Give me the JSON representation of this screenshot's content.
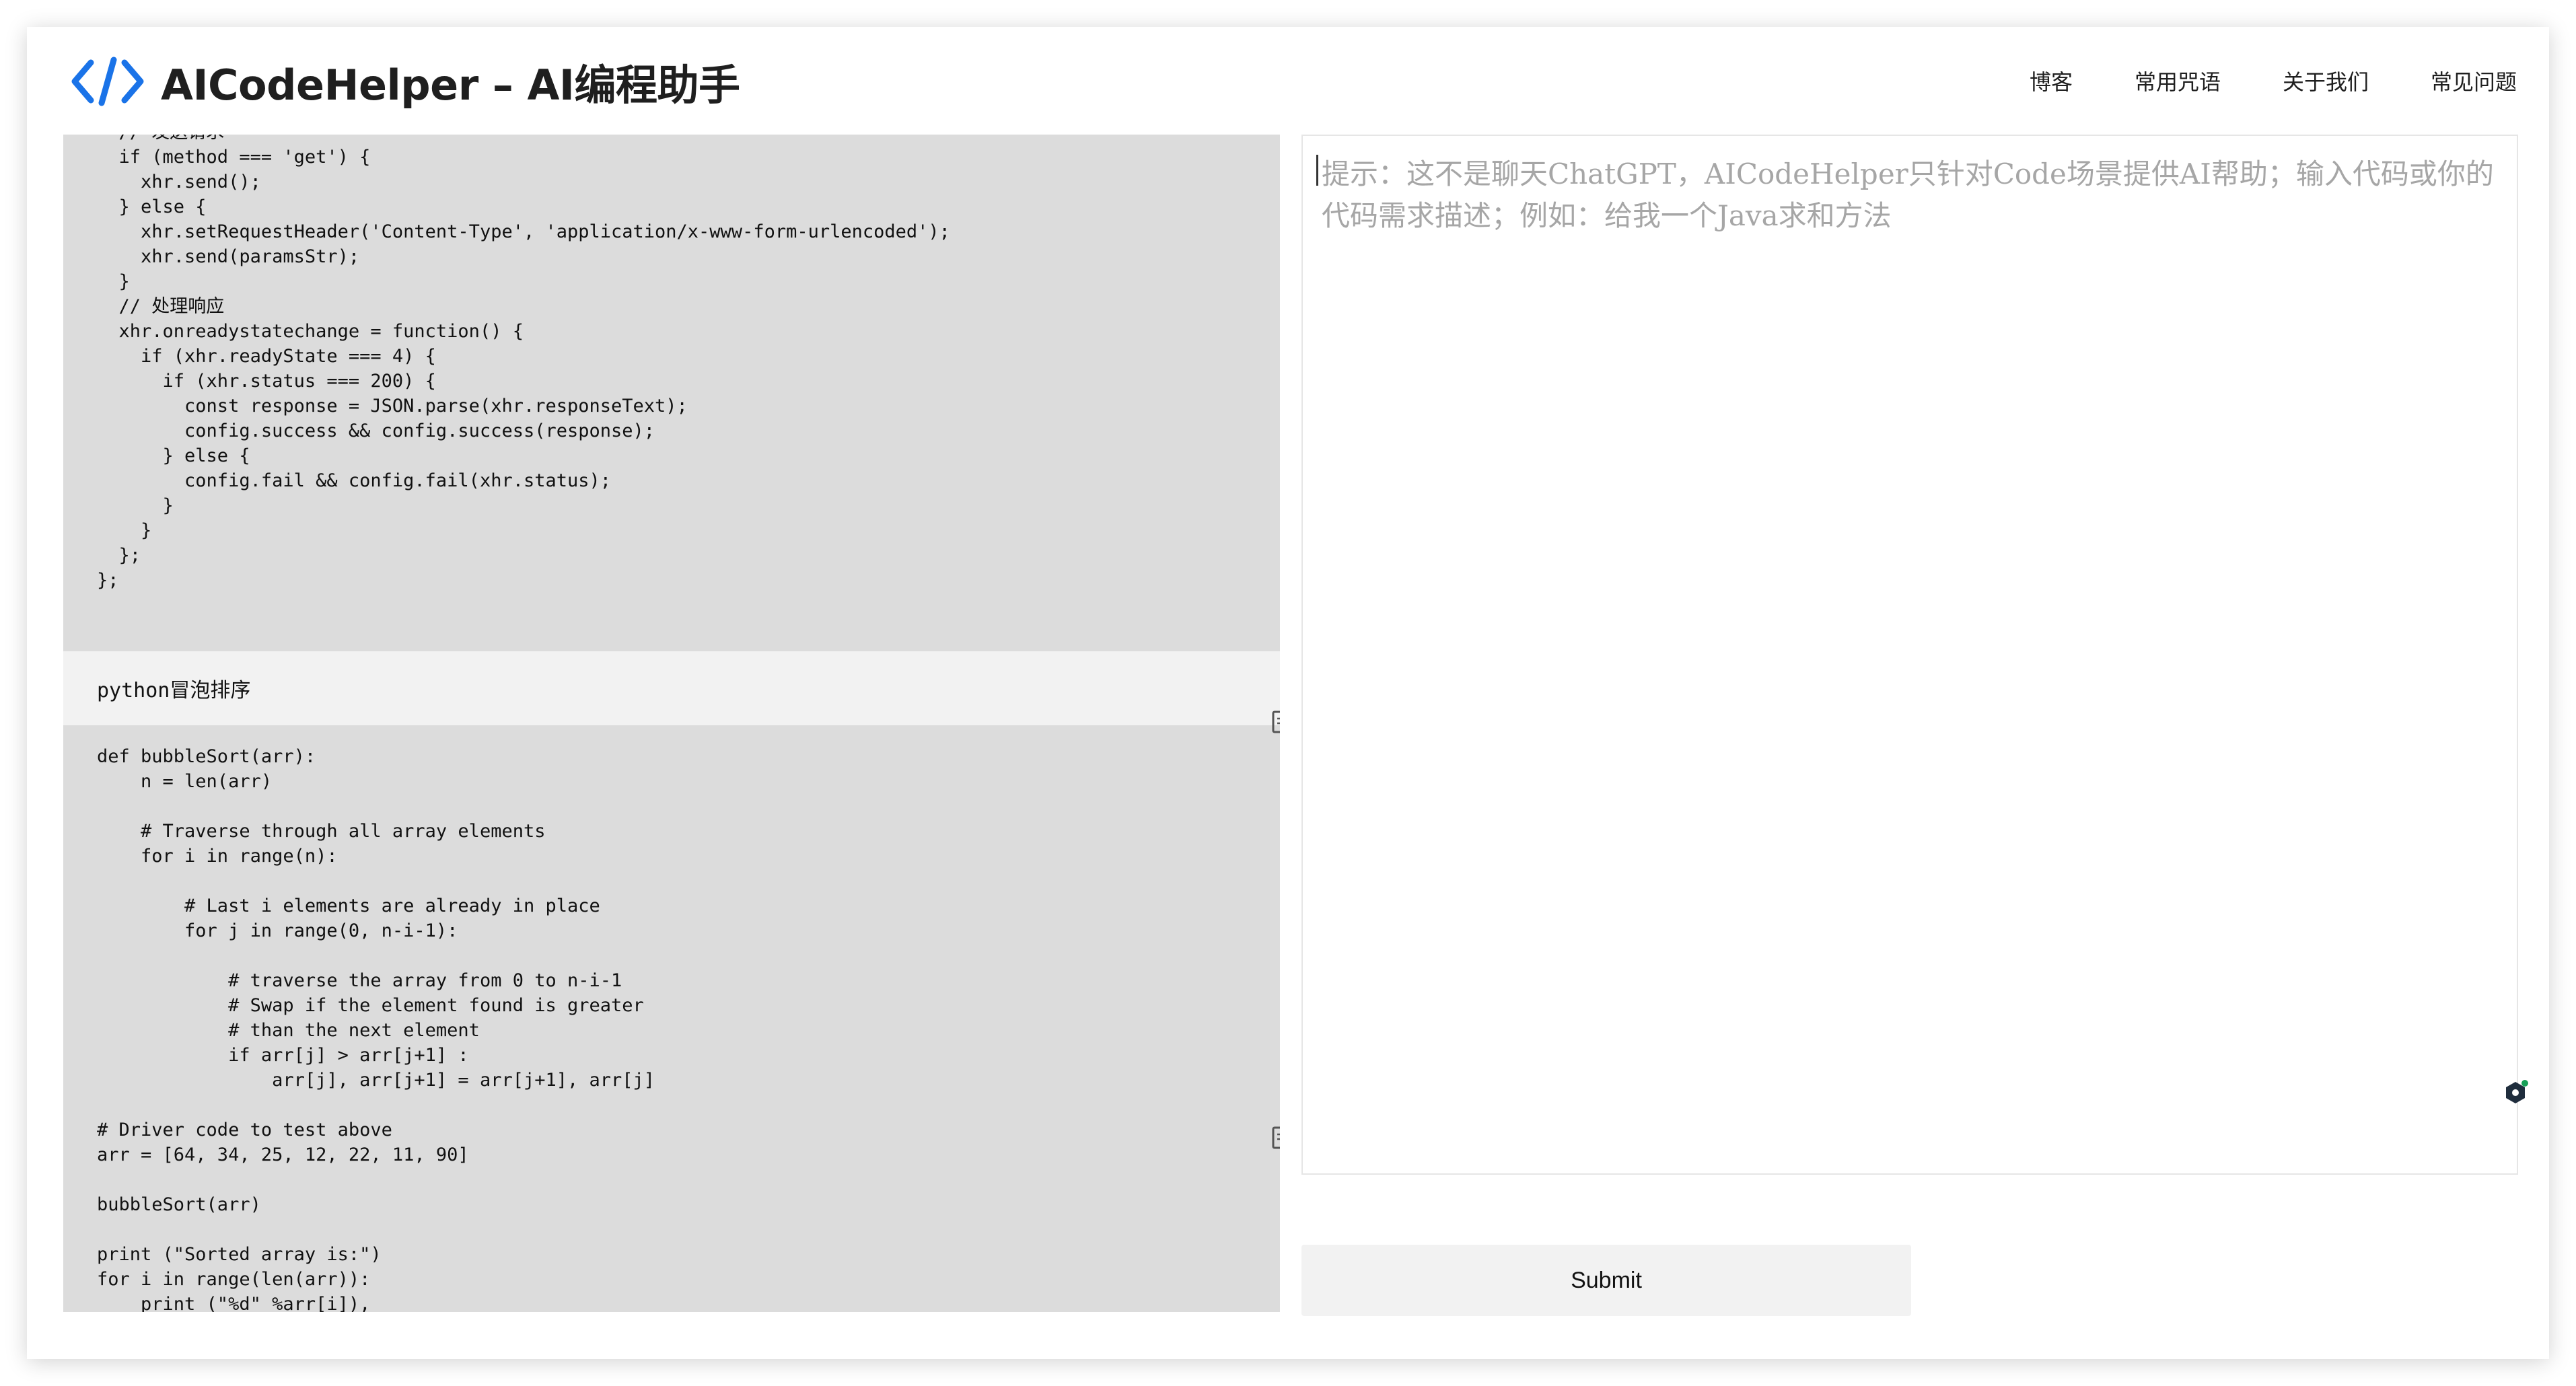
{
  "header": {
    "logo_icon": "code-brackets-icon",
    "brand_color": "#1a73e8",
    "title": "AICodeHelper – AI编程助手",
    "nav": [
      {
        "label": "博客"
      },
      {
        "label": "常用咒语"
      },
      {
        "label": "关于我们"
      },
      {
        "label": "常见问题"
      }
    ]
  },
  "snippets": [
    {
      "title": "",
      "code": "  // 发送请求\n  if (method === 'get') {\n    xhr.send();\n  } else {\n    xhr.setRequestHeader('Content-Type', 'application/x-www-form-urlencoded');\n    xhr.send(paramsStr);\n  }\n  // 处理响应\n  xhr.onreadystatechange = function() {\n    if (xhr.readyState === 4) {\n      if (xhr.status === 200) {\n        const response = JSON.parse(xhr.responseText);\n        config.success && config.success(response);\n      } else {\n        config.fail && config.fail(xhr.status);\n      }\n    }\n  };\n};"
    },
    {
      "title": "python冒泡排序",
      "code": "def bubbleSort(arr):\n    n = len(arr)\n\n    # Traverse through all array elements\n    for i in range(n):\n\n        # Last i elements are already in place\n        for j in range(0, n-i-1):\n\n            # traverse the array from 0 to n-i-1\n            # Swap if the element found is greater\n            # than the next element\n            if arr[j] > arr[j+1] :\n                arr[j], arr[j+1] = arr[j+1], arr[j]\n\n# Driver code to test above\narr = [64, 34, 25, 12, 22, 11, 90]\n\nbubbleSort(arr)\n\nprint (\"Sorted array is:\")\nfor i in range(len(arr)):\n    print (\"%d\" %arr[i]),"
    }
  ],
  "icons": {
    "copy": "copy-icon",
    "assistant": "assistant-icon"
  },
  "input": {
    "value": "",
    "placeholder": "提示：这不是聊天ChatGPT，AICodeHelper只针对Code场景提供AI帮助；输入代码或你的代码需求描述；例如：给我一个Java求和方法"
  },
  "submit_label": "Submit"
}
